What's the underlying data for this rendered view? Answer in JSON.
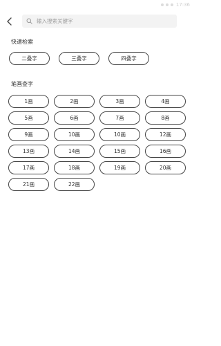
{
  "status_bar": {
    "time": "17:36"
  },
  "header": {
    "back_icon": "chevron-left-icon",
    "search": {
      "icon": "search-icon",
      "placeholder": "输入搜索关键字",
      "value": ""
    }
  },
  "quick_search": {
    "title": "快速检索",
    "items": [
      "二叠字",
      "三叠字",
      "四叠字"
    ]
  },
  "stroke_search": {
    "title": "笔画查字",
    "items": [
      "1画",
      "2画",
      "3画",
      "4画",
      "5画",
      "6画",
      "7画",
      "8画",
      "9画",
      "10画",
      "10画",
      "12画",
      "13画",
      "14画",
      "15画",
      "16画",
      "17画",
      "18画",
      "19画",
      "20画",
      "21画",
      "22画"
    ]
  }
}
